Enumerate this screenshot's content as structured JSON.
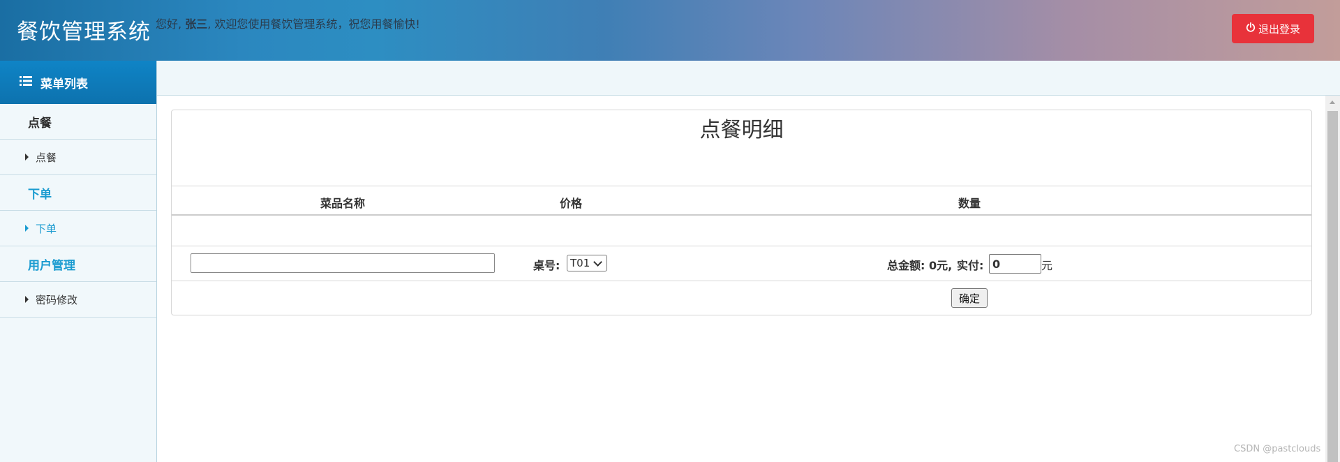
{
  "header": {
    "brand": "餐饮管理系统",
    "welcome_prefix": "您好, ",
    "username": "张三",
    "welcome_suffix": ", 欢迎您使用餐饮管理系统，祝您用餐愉快!",
    "logout_label": "退出登录",
    "logout_icon": "power-icon",
    "logout_color": "#e8323a"
  },
  "sidebar": {
    "title": "菜单列表",
    "title_icon": "list-icon",
    "groups": [
      {
        "title": "点餐",
        "items": [
          {
            "label": "点餐"
          }
        ]
      },
      {
        "title": "下单",
        "items": [
          {
            "label": "下单"
          }
        ]
      },
      {
        "title": "用户管理",
        "items": [
          {
            "label": "密码修改"
          }
        ]
      }
    ],
    "accent_color": "#1a9bd0"
  },
  "main": {
    "title": "点餐明细",
    "columns": [
      "菜品名称",
      "价格",
      "数量"
    ],
    "dish_name_value": "",
    "table_label": "桌号:",
    "table_selected": "T01",
    "total_label": "总金额: 0元,",
    "paid_label": "实付:",
    "paid_value": "0",
    "currency": "元",
    "confirm_label": "确定"
  },
  "watermark": "CSDN @pastclouds"
}
